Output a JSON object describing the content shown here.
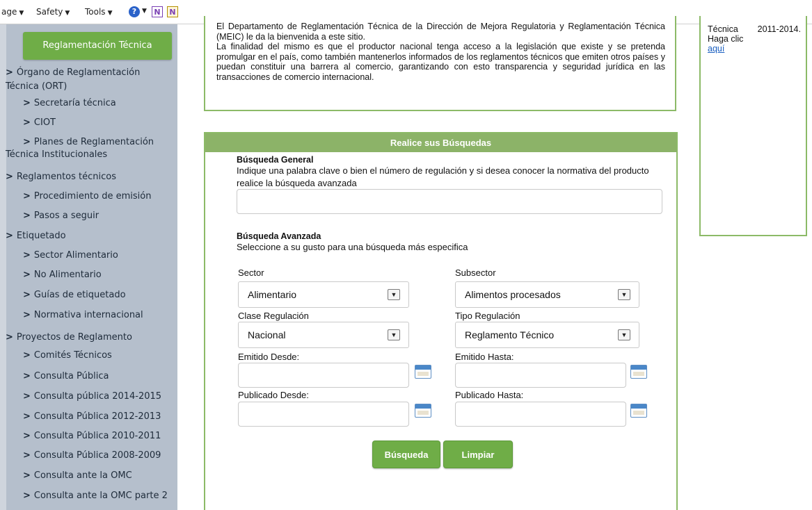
{
  "toolbar": {
    "page_menu": "age",
    "safety_menu": "Safety",
    "tools_menu": "Tools",
    "help_icon": "help-icon",
    "onenote_icons": [
      "N",
      "N"
    ]
  },
  "sidebar": {
    "header_button": "Reglamentación Técnica",
    "items": [
      {
        "label": "Órgano de Reglamentación",
        "label2": "Técnica (ORT)",
        "level": 0
      },
      {
        "label": "Secretaría técnica",
        "level": 1
      },
      {
        "label": "CIOT",
        "level": 1
      },
      {
        "label": "Planes de Reglamentación",
        "label2": "Técnica Institucionales",
        "level": 1
      },
      {
        "label": "Reglamentos técnicos",
        "level": 0
      },
      {
        "label": "Procedimiento de emisión",
        "level": 1
      },
      {
        "label": "Pasos a seguir",
        "level": 1
      },
      {
        "label": "Etiquetado",
        "level": 0
      },
      {
        "label": "Sector Alimentario",
        "level": 1
      },
      {
        "label": "No Alimentario",
        "level": 1
      },
      {
        "label": "Guías de etiquetado",
        "level": 1
      },
      {
        "label": "Normativa internacional",
        "level": 1
      },
      {
        "label": "Proyectos de Reglamento",
        "level": 0
      },
      {
        "label": "Comités Técnicos",
        "level": 1
      },
      {
        "label": "Consulta Pública",
        "level": 1
      },
      {
        "label": "Consulta pública 2014-2015",
        "level": 1
      },
      {
        "label": "Consulta Pública 2012-2013",
        "level": 1
      },
      {
        "label": "Consulta Pública 2010-2011",
        "level": 1
      },
      {
        "label": "Consulta Pública 2008-2009",
        "level": 1
      },
      {
        "label": "Consulta ante la OMC",
        "level": 1
      },
      {
        "label": "Consulta ante la OMC parte 2",
        "level": 1
      }
    ]
  },
  "intro": {
    "line1": "El Departamento de Reglamentación Técnica de la Dirección de Mejora Regulatoria y Reglamentación Técnica (MEIC) le da la bienvenida a este sitio.",
    "line2": "La finalidad del mismo es que el productor nacional tenga acceso a la legislación que existe y se pretenda promulgar en el país, como también mantenerlos informados de los reglamentos técnicos que emiten otros países y puedan constituir una barrera al comercio, garantizando con esto transparencia y seguridad jurídica en las transacciones de comercio internacional."
  },
  "search": {
    "header": "Realice sus Búsquedas",
    "general_title": "Búsqueda General",
    "general_desc": "Indique una palabra clave o bien el número de regulación y si desea conocer la normativa del producto realice la búsqueda avanzada",
    "general_value": "",
    "advanced_title": "Búsqueda Avanzada",
    "advanced_desc": "Seleccione a su gusto para una búsqueda más especifica",
    "sector_label": "Sector",
    "sector_value": "Alimentario",
    "subsector_label": "Subsector",
    "subsector_value": "Alimentos procesados",
    "clase_label": "Clase Regulación",
    "clase_value": "Nacional",
    "tipo_label": "Tipo Regulación",
    "tipo_value": "Reglamento Técnico",
    "emitido_desde_label": "Emitido Desde:",
    "emitido_hasta_label": "Emitido Hasta:",
    "publicado_desde_label": "Publicado Desde:",
    "publicado_hasta_label": "Publicado Hasta:",
    "search_button": "Búsqueda",
    "clear_button": "Limpiar"
  },
  "right_box": {
    "text": "Técnica 2011-2014. Haga clic",
    "link": "aquí"
  },
  "colors": {
    "accent_green": "#6fad47",
    "panel_header": "#8cb368",
    "sidebar_bg": "#b5bfcc",
    "link": "#1a5fc0"
  }
}
